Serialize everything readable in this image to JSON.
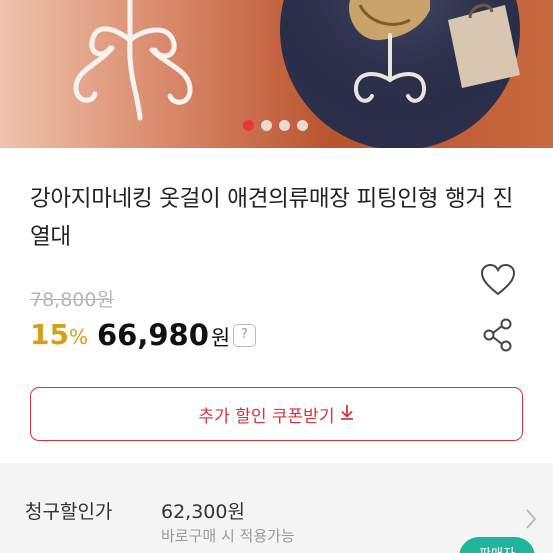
{
  "product": {
    "title": "강아지마네킹 옷걸이 애견의류매장 피팅인형 행거 진열대",
    "original_price": "78,800원",
    "discount_value": "15",
    "discount_unit": "%",
    "price_value": "66,980",
    "price_unit": "원",
    "help_label": "?"
  },
  "carousel": {
    "dots": 4,
    "active_index": 0
  },
  "coupon_button": {
    "label": "추가 할인 쿠폰받기"
  },
  "claim": {
    "label": "청구할인가",
    "price": "62,300원",
    "sub": "바로구매 시 적용가능"
  },
  "fab": {
    "label": "판매자"
  },
  "colors": {
    "accent": "#d9333c",
    "discount": "#d4a017",
    "fab": "#1fb59c"
  },
  "icons": [
    "heart-icon",
    "share-icon",
    "download-arrow-icon",
    "chevron-right-icon",
    "question-icon"
  ]
}
